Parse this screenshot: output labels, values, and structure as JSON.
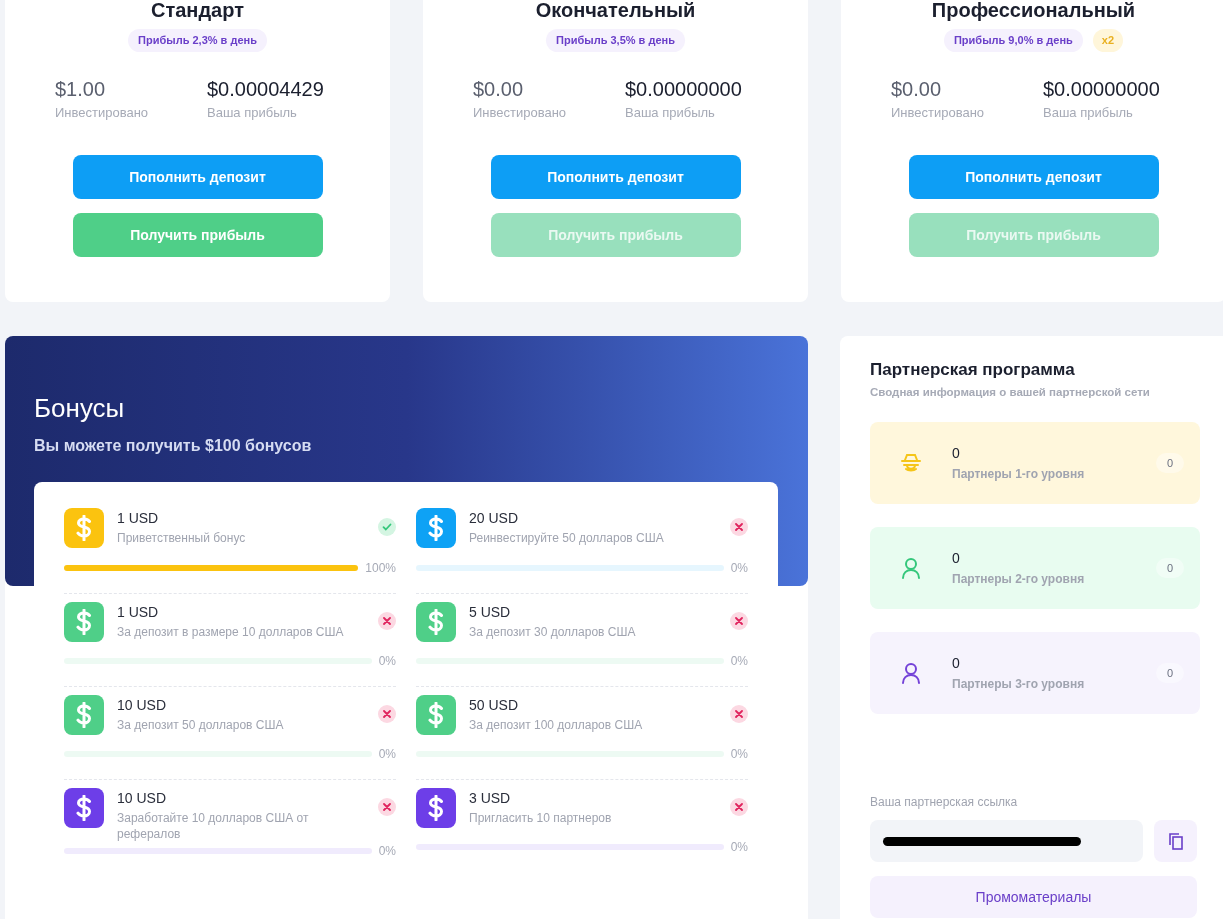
{
  "plans": [
    {
      "title": "Стандарт",
      "rate": "Прибыль 2,3% в день",
      "invested": "$1.00",
      "invested_label": "Инвестировано",
      "profit": "$0.00004429",
      "profit_label": "Ваша прибыль",
      "deposit_button": "Пополнить депозит",
      "claim_button": "Получить прибыль",
      "claim_disabled": false
    },
    {
      "title": "Окончательный",
      "rate": "Прибыль 3,5% в день",
      "invested": "$0.00",
      "invested_label": "Инвестировано",
      "profit": "$0.00000000",
      "profit_label": "Ваша прибыль",
      "deposit_button": "Пополнить депозит",
      "claim_button": "Получить прибыль",
      "claim_disabled": true
    },
    {
      "title": "Профессиональный",
      "rate": "Прибыль 9,0% в день",
      "multiplier": "x2",
      "invested": "$0.00",
      "invested_label": "Инвестировано",
      "profit": "$0.00000000",
      "profit_label": "Ваша прибыль",
      "deposit_button": "Пополнить депозит",
      "claim_button": "Получить прибыль",
      "claim_disabled": true
    }
  ],
  "bonuses": {
    "title": "Бонусы",
    "subtitle": "Вы можете получить $100 бонусов",
    "items": [
      {
        "amount": "1 USD",
        "description": "Приветственный бонус",
        "color": "#fbc30f",
        "done": true,
        "level": 1,
        "percent": "100%"
      },
      {
        "amount": "20 USD",
        "description": "Реинвестируйте 50 долларов США",
        "color": "#0ea2f5",
        "done": false,
        "level": 0,
        "percent": "0%"
      },
      {
        "amount": "1 USD",
        "description": "За депозит в размере 10 долларов США",
        "color": "#4fcf88",
        "done": false,
        "level": 0,
        "percent": "0%"
      },
      {
        "amount": "5 USD",
        "description": "За депозит 30 долларов США",
        "color": "#4fcf88",
        "done": false,
        "level": 0,
        "percent": "0%"
      },
      {
        "amount": "10 USD",
        "description": "За депозит 50 долларов США",
        "color": "#4fcf88",
        "done": false,
        "level": 0,
        "percent": "0%"
      },
      {
        "amount": "50 USD",
        "description": "За депозит 100 долларов США",
        "color": "#4fcf88",
        "done": false,
        "level": 0,
        "percent": "0%"
      },
      {
        "amount": "10 USD",
        "description": "Заработайте 10 долларов США от рефералов",
        "color": "#6d3ee8",
        "done": false,
        "level": 0,
        "percent": "0%"
      },
      {
        "amount": "3 USD",
        "description": "Пригласить 10 партнеров",
        "color": "#6d3ee8",
        "done": false,
        "level": 0,
        "percent": "0%"
      }
    ]
  },
  "partners": {
    "title": "Партнерская программа",
    "subtitle": "Сводная информация о вашей партнерской сети",
    "levels": [
      {
        "count": "0",
        "label": "Партнеры 1-го уровня",
        "badge": "0",
        "kind": "spy",
        "color": "#f5c518"
      },
      {
        "count": "0",
        "label": "Партнеры 2-го уровня",
        "badge": "0",
        "kind": "person",
        "color": "#34c77b"
      },
      {
        "count": "0",
        "label": "Партнеры 3-го уровня",
        "badge": "0",
        "kind": "person",
        "color": "#7442d8"
      }
    ],
    "link_label": "Ваша партнерская ссылка",
    "link_redacted": true,
    "promo_button": "Промоматериалы"
  }
}
